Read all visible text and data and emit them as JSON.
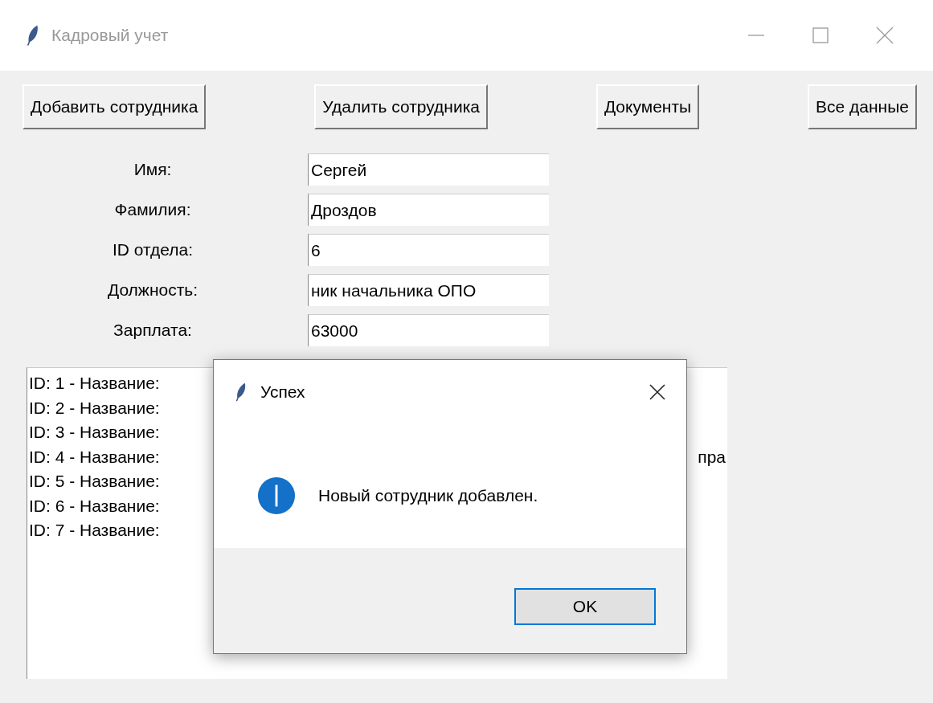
{
  "window": {
    "title": "Кадровый учет"
  },
  "toolbar": [
    "Добавить сотрудника",
    "Удалить сотрудника",
    "Документы",
    "Все данные"
  ],
  "form": [
    {
      "label": "Имя:",
      "value": "Сергей"
    },
    {
      "label": "Фамилия:",
      "value": "Дроздов"
    },
    {
      "label": "ID отдела:",
      "value": "6"
    },
    {
      "label": "Должность:",
      "value": "ник начальника ОПО"
    },
    {
      "label": "Зарплата:",
      "value": "63000"
    }
  ],
  "list": [
    {
      "text": "ID: 1 - Название:"
    },
    {
      "text": "ID: 2 - Название:"
    },
    {
      "text": "ID: 3 - Название:"
    },
    {
      "text": "ID: 4 - Название:",
      "tail": "пра"
    },
    {
      "text": "ID: 5 - Название:"
    },
    {
      "text": "ID: 6 - Название:"
    },
    {
      "text": "ID: 7 - Название:"
    }
  ],
  "dialog": {
    "title": "Успех",
    "message": "Новый сотрудник добавлен.",
    "button": "OK"
  }
}
